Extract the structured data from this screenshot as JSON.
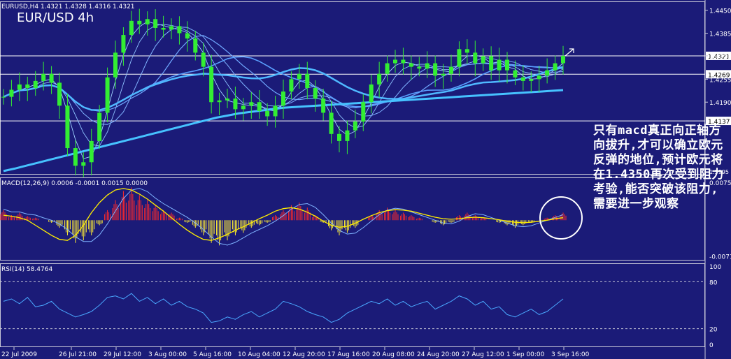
{
  "chart_data": {
    "type": "candlestick",
    "symbol_header": "EURUSD,H4  1.4321 1.4328 1.4316 1.4321",
    "title": "EUR/USD 4h",
    "annotation": "只有macd真正向正轴方向拔升,才可以确立欧元反弹的地位,预计欧元将在1.4350再次受到阻力考验,能否突破该阻力,需要进一步观察",
    "colors": {
      "background": "#1b1b78",
      "candles": "#33ee33",
      "ma_fast": "#7fb3ff",
      "ma_slow": "#46c2ff",
      "macd_positive": "#ff2a2a",
      "macd_negative": "#ffee33",
      "macd_signal": "#ffee00",
      "rsi_line": "#4aa8ff",
      "levels": "#ffffff"
    },
    "price_pane": {
      "ylim": [
        1.3985,
        1.4475
      ],
      "yticks": [
        1.445,
        1.4385,
        1.4321,
        1.4255,
        1.419
      ],
      "ytick_labels": [
        "1.4450",
        "1.4385",
        "1.4321",
        "1.4255",
        "1.4190"
      ],
      "partial_tick": "1.3995",
      "horizontal_levels": [
        {
          "label": "1.4321",
          "value": 1.4321
        },
        {
          "label": "1.4269",
          "value": 1.4269
        },
        {
          "label": "1.4137",
          "value": 1.4137
        }
      ],
      "close_series": [
        1.4205,
        1.4225,
        1.424,
        1.423,
        1.425,
        1.427,
        1.4245,
        1.418,
        1.406,
        1.401,
        1.402,
        1.408,
        1.416,
        1.426,
        1.433,
        1.438,
        1.442,
        1.441,
        1.4425,
        1.44,
        1.4395,
        1.4405,
        1.4385,
        1.437,
        1.433,
        1.429,
        1.419,
        1.4195,
        1.42,
        1.417,
        1.418,
        1.419,
        1.4165,
        1.415,
        1.418,
        1.422,
        1.4255,
        1.427,
        1.423,
        1.42,
        1.416,
        1.41,
        1.408,
        1.411,
        1.4135,
        1.419,
        1.424,
        1.427,
        1.43,
        1.431,
        1.43,
        1.429,
        1.4285,
        1.43,
        1.4265,
        1.427,
        1.429,
        1.434,
        1.433,
        1.43,
        1.432,
        1.428,
        1.431,
        1.428,
        1.426,
        1.425,
        1.4255,
        1.4265,
        1.428,
        1.43,
        1.4321
      ]
    },
    "macd_pane": {
      "label": "MACD(12,26,9) 0.0006 -0.0001 0.0015 0.0000",
      "ylim": [
        -0.008,
        0.0085
      ],
      "yticks": [
        0.0075,
        -0.0071
      ],
      "ytick_labels": [
        "0.0075",
        "-0.0071"
      ],
      "histogram": [
        0.002,
        0.001,
        0.0015,
        0.0008,
        0.0005,
        0.0,
        -0.0005,
        -0.0015,
        -0.003,
        -0.0045,
        -0.004,
        -0.003,
        -0.001,
        0.002,
        0.004,
        0.0058,
        0.0065,
        0.005,
        0.004,
        0.003,
        0.002,
        0.0015,
        0.0005,
        -0.0005,
        -0.0015,
        -0.003,
        -0.0045,
        -0.005,
        -0.004,
        -0.003,
        -0.0025,
        -0.0015,
        -0.001,
        -0.0005,
        0.001,
        0.002,
        0.003,
        0.0035,
        0.0025,
        0.001,
        -0.0005,
        -0.002,
        -0.003,
        -0.0025,
        -0.0015,
        0.0,
        0.001,
        0.002,
        0.0025,
        0.002,
        0.0015,
        0.001,
        0.0005,
        0.0,
        -0.0005,
        -0.001,
        -0.0005,
        0.001,
        0.0015,
        0.001,
        0.0005,
        0.0,
        -0.0005,
        -0.001,
        -0.0015,
        -0.001,
        -0.0005,
        0.0,
        0.0005,
        0.001,
        0.0015
      ],
      "signal": [
        0.001,
        0.0008,
        0.0005,
        0.0,
        -0.001,
        -0.002,
        -0.003,
        -0.0038,
        -0.004,
        -0.003,
        -0.001,
        0.0015,
        0.0035,
        0.005,
        0.006,
        0.0063,
        0.006,
        0.0052,
        0.0042,
        0.003,
        0.0018,
        0.0005,
        -0.0008,
        -0.002,
        -0.003,
        -0.0038,
        -0.004,
        -0.0035,
        -0.0028,
        -0.002,
        -0.0013,
        -0.0005,
        0.0003,
        0.001,
        0.0018,
        0.0023,
        0.0025,
        0.0022,
        0.0016,
        0.0008,
        -0.0002,
        -0.001,
        -0.0014,
        -0.0012,
        -0.0006,
        0.0002,
        0.0009,
        0.0015,
        0.0019,
        0.0021,
        0.002,
        0.0018,
        0.0014,
        0.001,
        0.0006,
        0.0003,
        0.0002,
        0.0003,
        0.0005,
        0.0006,
        0.0005,
        0.0003,
        0.0001,
        -0.0002,
        -0.0004,
        -0.0005,
        -0.0004,
        -0.0002,
        0.0,
        0.0003,
        0.0005
      ]
    },
    "rsi_pane": {
      "label": "RSI(14) 58.4764",
      "ylim": [
        0,
        100
      ],
      "yticks": [
        100,
        80,
        20,
        0
      ],
      "ytick_labels": [
        "100",
        "80",
        "20",
        "0"
      ],
      "levels": [
        80,
        20
      ],
      "values": [
        55,
        58,
        52,
        60,
        48,
        50,
        55,
        45,
        40,
        35,
        38,
        42,
        50,
        60,
        62,
        58,
        65,
        55,
        60,
        52,
        58,
        50,
        55,
        48,
        45,
        40,
        28,
        30,
        35,
        32,
        38,
        42,
        35,
        40,
        45,
        55,
        52,
        48,
        42,
        38,
        35,
        28,
        32,
        40,
        45,
        50,
        55,
        52,
        58,
        50,
        55,
        48,
        52,
        55,
        45,
        50,
        55,
        62,
        58,
        50,
        55,
        45,
        48,
        38,
        35,
        40,
        45,
        38,
        42,
        50,
        58
      ]
    },
    "xtick_labels": [
      "22 Jul 2009",
      "26 Jul 21:00",
      "29 Jul 12:00",
      "3 Aug 00:00",
      "5 Aug 16:00",
      "10 Aug 04:00",
      "12 Aug 20:00",
      "17 Aug 16:00",
      "20 Aug 08:00",
      "24 Aug 20:00",
      "27 Aug 12:00",
      "1 Sep 00:00",
      "3 Sep 16:00"
    ]
  }
}
